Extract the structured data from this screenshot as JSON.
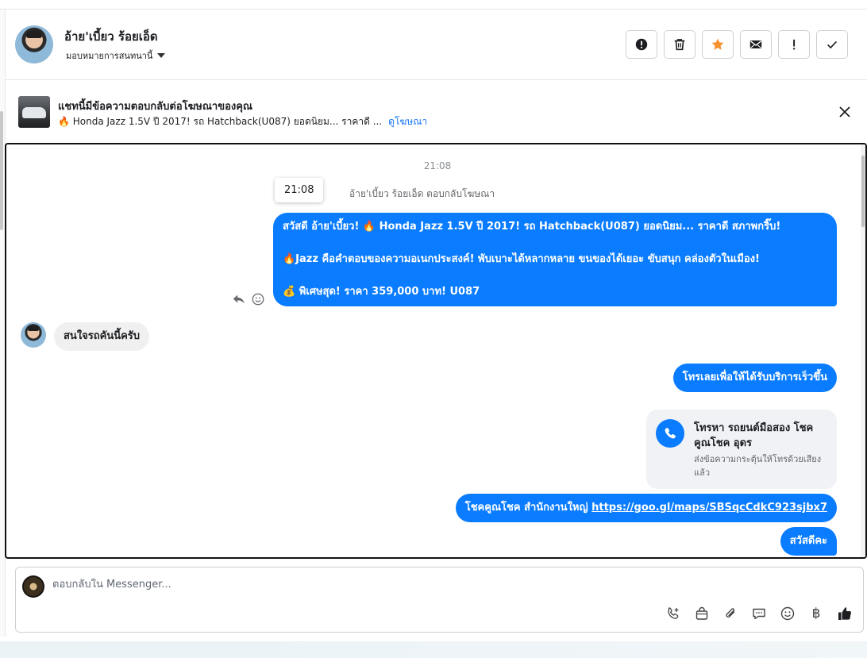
{
  "header": {
    "contact_name": "อ้าย'เบี้ยว ร้อยเอ็ด",
    "assign_label": "มอบหมายการสนทนานี้",
    "actions": [
      {
        "name": "spam-button",
        "icon": "alert-circle-icon"
      },
      {
        "name": "delete-button",
        "icon": "trash-icon"
      },
      {
        "name": "star-button",
        "icon": "star-icon",
        "color": "#f5922f"
      },
      {
        "name": "mark-unread-button",
        "icon": "envelope-icon"
      },
      {
        "name": "follow-up-button",
        "icon": "exclamation-icon"
      },
      {
        "name": "mark-done-button",
        "icon": "check-icon"
      }
    ]
  },
  "ad_banner": {
    "title": "แชทนี้มีข้อความตอบกลับต่อโฆษณาของคุณ",
    "ad_text": "🔥 Honda Jazz 1.5V ปี 2017! รถ Hatchback(U087) ยอดนิยม... ราคาดี ...",
    "link_label": "ดูโฆษณา"
  },
  "thread": {
    "time_divider": "21:08",
    "tooltip_time": "21:08",
    "reply_note": "อ้าย'เบี้ยว ร้อยเอ็ด ตอบกลับโฆษณา",
    "ad_message": [
      "สวัสดี อ้าย'เบี้ยว! 🔥 Honda Jazz 1.5V ปี 2017! รถ Hatchback(U087) ยอดนิยม... ราคาดี สภาพกริ๊บ!",
      "🔥Jazz คือคำตอบของความอเนกประสงค์! พับเบาะได้หลากหลาย ขนของได้เยอะ ขับสนุก คล่องตัวในเมือง!",
      "💰 พิเศษสุด! ราคา 359,000 บาท! U087"
    ],
    "incoming_message": "สนใจรถคันนี้ครับ",
    "call_prompt_message": "โทรเลยเพื่อให้ได้รับบริการเร็วขึ้น",
    "call_card": {
      "title": "โทรหา รถยนต์มือสอง โชคคูณโชค อุดร",
      "subtitle": "ส่งข้อความกระตุ้นให้โทรด้วยเสียงแล้ว"
    },
    "location_prefix": "โชคคูณโชค สำนักงานใหญ่ ",
    "location_link": "https://goo.gl/maps/SBSqcCdkC923sjbx7",
    "greeting_message": "สวัสดีคะ",
    "colors": {
      "outgoing": "#0a7cff",
      "incoming": "#f0f0f0"
    }
  },
  "composer": {
    "placeholder": "ตอบกลับใน Messenger...",
    "tools": [
      "phone-plus-icon",
      "shopping-bag-icon",
      "paperclip-icon",
      "chat-bubble-icon",
      "emoji-icon",
      "baht-icon",
      "thumbs-up-icon"
    ],
    "baht_symbol": "฿"
  }
}
